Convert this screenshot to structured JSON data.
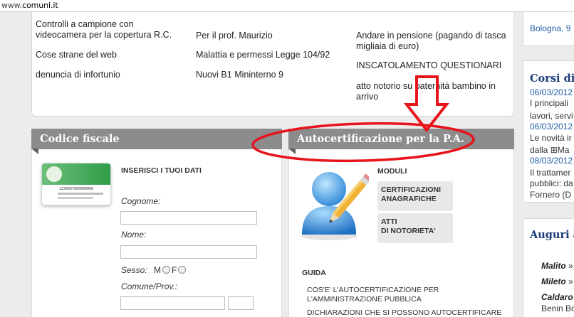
{
  "address_bar": {
    "prefix": "www.",
    "domain": "comuni.it"
  },
  "top_links": {
    "col1": [
      "Controlli a campione con videocamera per la copertura R.C.",
      "Cose strane del web",
      "denuncia di infortunio"
    ],
    "col2": [
      "Per il prof. Maurizio",
      "Malattia e permessi Legge 104/92",
      "Nuovi B1 Mininterno 9"
    ],
    "col3": [
      "Andare in pensione (pagando di tasca migliaia di euro)",
      "INSCATOLAMENTO QUESTIONARI",
      "atto notorio su paternità bambino in arrivo"
    ]
  },
  "codice_fiscale": {
    "title": "Codice fiscale",
    "form_title": "INSERISCI I TUOI DATI",
    "card_number": "1234567890000000",
    "labels": {
      "cognome": "Cognome:",
      "nome": "Nome:",
      "sesso": "Sesso:",
      "m": "M",
      "f": "F",
      "comune": "Comune/Prov.:"
    }
  },
  "autocertificazione": {
    "title": "Autocertificazione per la P.A.",
    "moduli_label": "MODULI",
    "buttons": [
      {
        "line1": "CERTIFICAZIONI",
        "line2": "ANAGRAFICHE"
      },
      {
        "line1": "ATTI",
        "line2": "DI NOTORIETA'"
      }
    ],
    "guida_label": "GUIDA",
    "guida_links": [
      "COS'E' L'AUTOCERTIFICAZIONE PER",
      "L'AMMINISTRAZIONE PUBBLICA",
      "DICHIARAZIONI CHE SI POSSONO AUTOCERTIFICARE"
    ]
  },
  "right_column": {
    "top_text": "Bologna, 9",
    "corsi": {
      "title": "Corsi di f",
      "lines": [
        {
          "date": "06/03/2012",
          "text": [
            "I principali",
            "lavori, servi"
          ]
        },
        {
          "date": "06/03/2012",
          "text": [
            "Le novità ir",
            "dalla ⊞Ma"
          ]
        },
        {
          "date": "08/03/2012",
          "text": [
            "Il trattamer",
            "pubblici: da",
            "Fornero (D"
          ]
        }
      ]
    },
    "auguri": {
      "title": "Auguri a",
      "names": [
        {
          "name": "Malito",
          "suffix": " »"
        },
        {
          "name": "Mileto",
          "suffix": " »"
        },
        {
          "name": "Caldaro",
          "suffix": ""
        }
      ],
      "extra": "Benin Bo"
    }
  },
  "colors": {
    "header_gray": "#8c8c8c",
    "annotation_red": "#e8141c",
    "link_blue": "#1f5da8",
    "title_blue": "#1a3d7a"
  }
}
